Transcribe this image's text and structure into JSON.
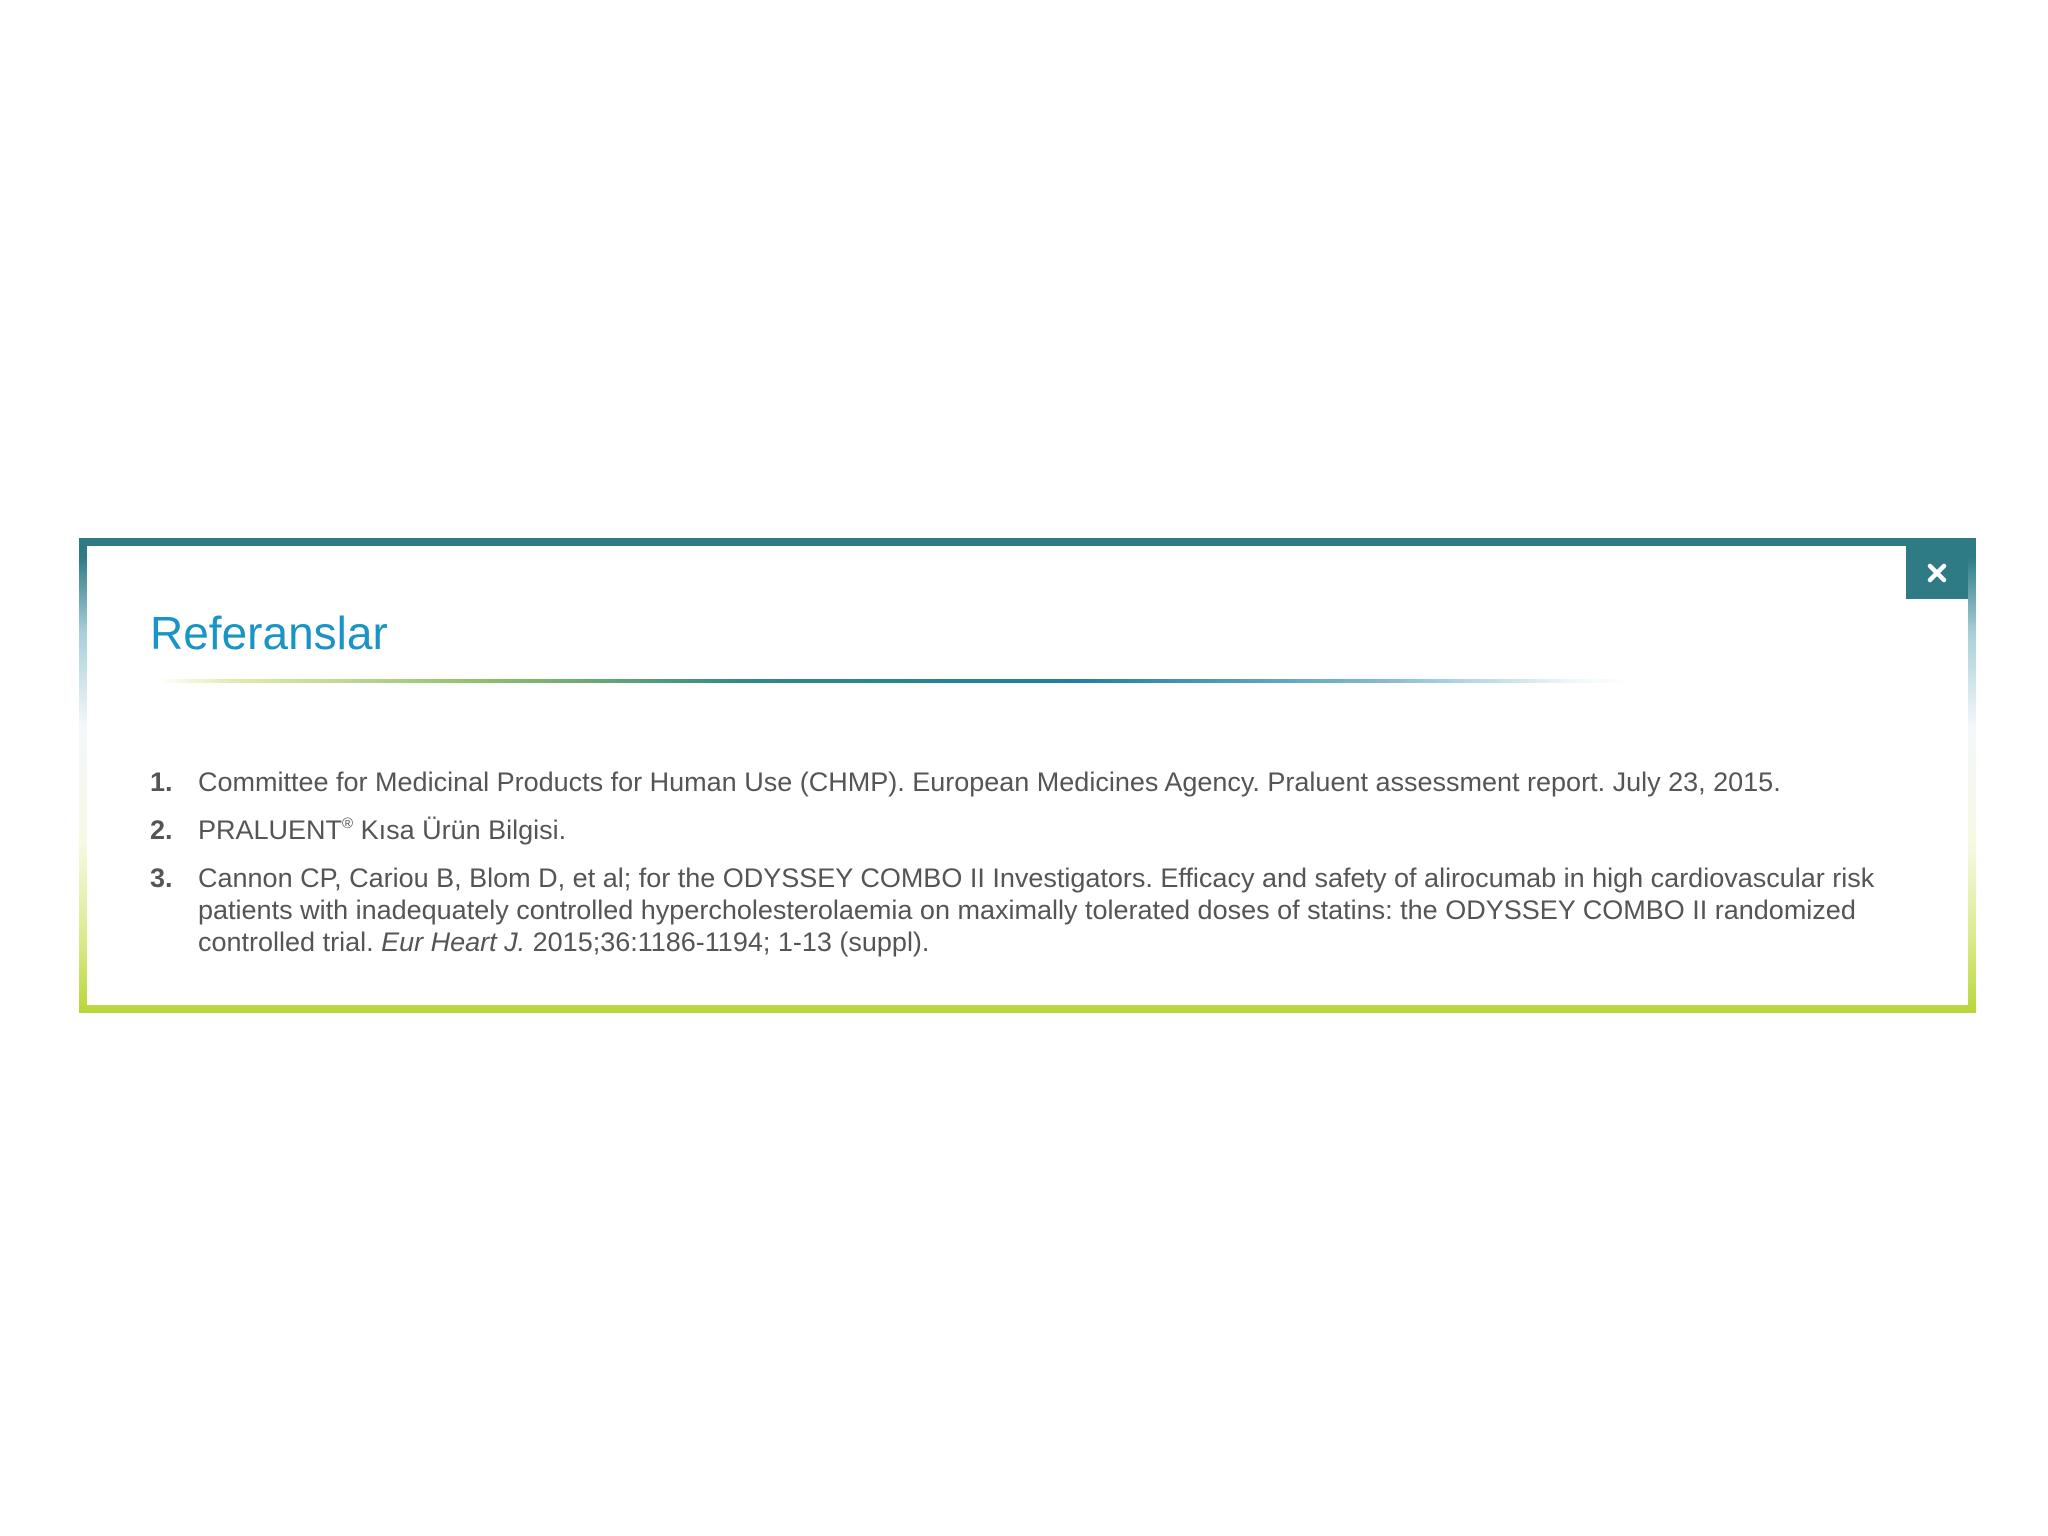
{
  "modal": {
    "title": "Referanslar",
    "close_label": "close"
  },
  "references": [
    {
      "number": "1.",
      "text": "Committee for Medicinal Products for Human Use (CHMP). European Medicines Agency. Praluent assessment report. July 23, 2015."
    },
    {
      "number": "2.",
      "text_before_sup": "PRALUENT",
      "sup": "®",
      "text_after_sup": " Kısa Ürün Bilgisi."
    },
    {
      "number": "3.",
      "text_before_italic": "Cannon CP, Cariou B, Blom D, et al; for the ODYSSEY COMBO II Investigators. Efficacy and safety of alirocumab in high cardiovascular risk patients with inadequately controlled hypercholesterolaemia on maximally tolerated doses of statins: the ODYSSEY COMBO II randomized controlled trial. ",
      "italic": "Eur Heart J.",
      "text_after_italic": " 2015;36:1186-1194; 1-13 (suppl)."
    }
  ],
  "colors": {
    "accent_teal": "#2e7a85",
    "title_blue": "#1a93c6",
    "border_lime": "#b9d63a",
    "body_text": "#555555"
  },
  "icons": {
    "close": "close-icon"
  }
}
